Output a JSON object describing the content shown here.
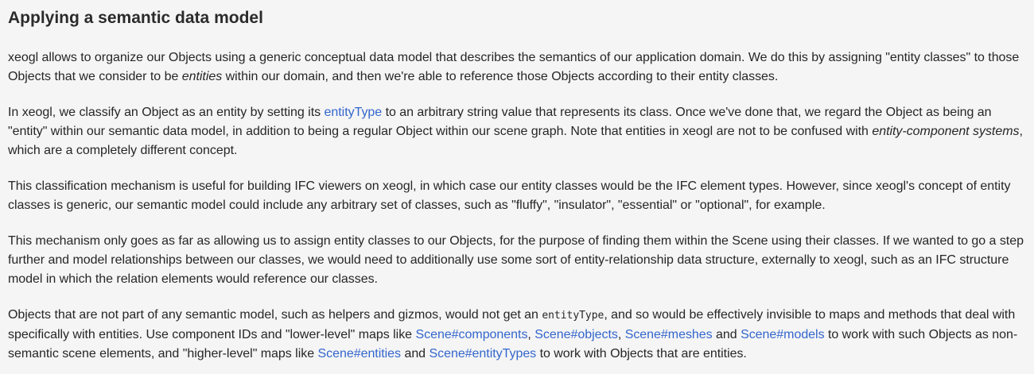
{
  "heading": "Applying a semantic data model",
  "p1": {
    "t1": "xeogl allows to organize our Objects using a generic conceptual data model that describes the semantics of our application domain. We do this by assigning \"entity classes\" to those Objects that we consider to be ",
    "em1": "entities",
    "t2": " within our domain, and then we're able to reference those Objects according to their entity classes."
  },
  "p2": {
    "t1": "In xeogl, we classify an Object as an entity by setting its ",
    "link_entityType": "entityType",
    "t2": " to an arbitrary string value that represents its class. Once we've done that, we regard the Object as being an \"entity\" within our semantic data model, in addition to being a regular Object within our scene graph. Note that entities in xeogl are not to be confused with ",
    "em1": "entity-component systems",
    "t3": ", which are a completely different concept."
  },
  "p3": {
    "text": "This classification mechanism is useful for building IFC viewers on xeogl, in which case our entity classes would be the IFC element types. However, since xeogl's concept of entity classes is generic, our semantic model could include any arbitrary set of classes, such as \"fluffy\", \"insulator\", \"essential\" or \"optional\", for example."
  },
  "p4": {
    "text": "This mechanism only goes as far as allowing us to assign entity classes to our Objects, for the purpose of finding them within the Scene using their classes. If we wanted to go a step further and model relationships between our classes, we would need to additionally use some sort of entity-relationship data structure, externally to xeogl, such as an IFC structure model in which the relation elements would reference our classes."
  },
  "p5": {
    "t1": "Objects that are not part of any semantic model, such as helpers and gizmos, would not get an ",
    "code1": "entityType",
    "t2": ", and so would be effectively invisible to maps and methods that deal with specifically with entities. Use component IDs and \"lower-level\" maps like ",
    "link_components": "Scene#components",
    "sep1": ", ",
    "link_objects": "Scene#objects",
    "sep2": ", ",
    "link_meshes": "Scene#meshes",
    "t3": " and ",
    "link_models": "Scene#models",
    "t4": " to work with such Objects as non-semantic scene elements, and \"higher-level\" maps like ",
    "link_entities": "Scene#entities",
    "t5": " and ",
    "link_entityTypes": "Scene#entityTypes",
    "t6": " to work with Objects that are entities."
  }
}
